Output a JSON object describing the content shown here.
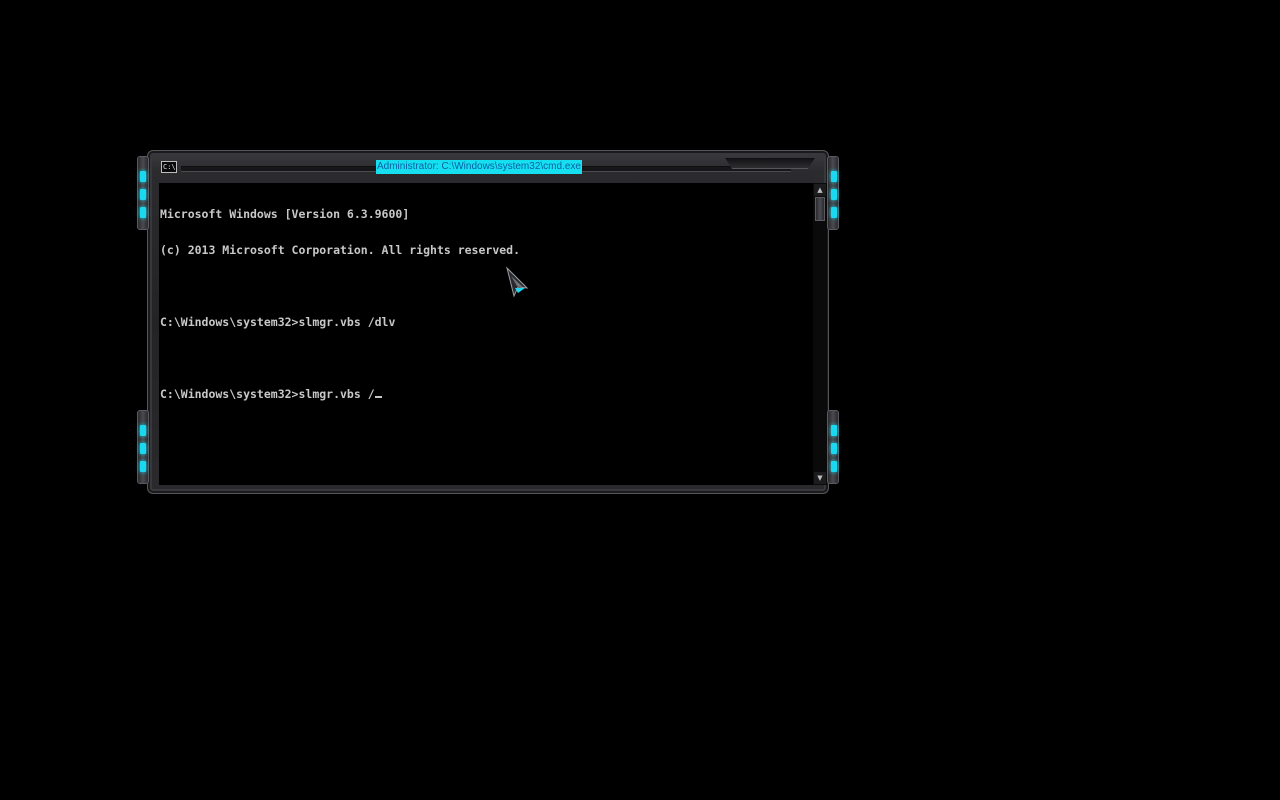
{
  "window": {
    "title": "Administrator: C:\\Windows\\system32\\cmd.exe",
    "system_icon_text": "C:\\."
  },
  "console": {
    "lines": [
      "Microsoft Windows [Version 6.3.9600]",
      "(c) 2013 Microsoft Corporation. All rights reserved.",
      "",
      "C:\\Windows\\system32>slmgr.vbs /dlv",
      "",
      "C:\\Windows\\system32>slmgr.vbs /"
    ]
  },
  "scrollbar": {
    "up_icon": "scroll-up-arrow",
    "down_icon": "scroll-down-arrow"
  },
  "colors": {
    "accent": "#1ad8f0",
    "title_highlight": "#16e0f0",
    "console_text": "#c8c8c8",
    "background": "#000000"
  }
}
